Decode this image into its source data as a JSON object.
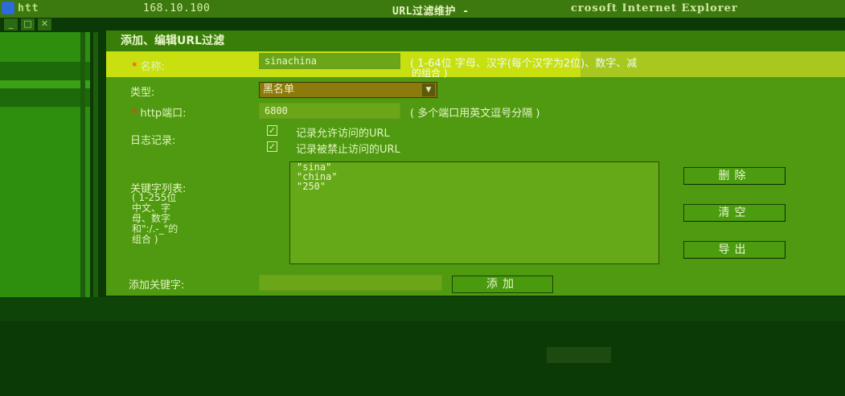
{
  "window": {
    "title_prefix": "htt",
    "title_ip": "168.10.100",
    "title_mid": "URL过滤维护 -",
    "title_app": "crosoft Internet Explorer",
    "controls": [
      "_",
      "□",
      "✕"
    ]
  },
  "dialog": {
    "header": "添加、编辑URL过滤",
    "name_label": "名称:",
    "name_value": "sinachina",
    "name_hint": "( 1-64位 字母、汉字(每个汉字为2位)、数字、减",
    "name_hint_2": "的组合 )",
    "type_label": "类型:",
    "type_value": "黑名单",
    "port_label": "http端口:",
    "port_value": "6800",
    "port_hint": "( 多个端口用英文逗号分隔 )",
    "log_label": "日志记录:",
    "log_options": [
      {
        "label": "记录允许访问的URL",
        "checked": true
      },
      {
        "label": "记录被禁止访问的URL",
        "checked": true
      }
    ],
    "kw_label": "关键字列表:",
    "kw_hint_lines": [
      "( 1-255位",
      "中文、字",
      "母、数字",
      "和\":/.-_\"的",
      "组合 )"
    ],
    "keywords": [
      "\"sina\"",
      "\"china\"",
      "\"250\""
    ],
    "buttons": {
      "delete": "删除",
      "clear": "清空",
      "export": "导出",
      "add": "添加"
    },
    "add_kw_label": "添加关键字:",
    "add_kw_value": ""
  },
  "colors": {
    "required": "#ff3010",
    "dialog_bg": "#4f9a10",
    "title_bar": "#3c7a10"
  }
}
